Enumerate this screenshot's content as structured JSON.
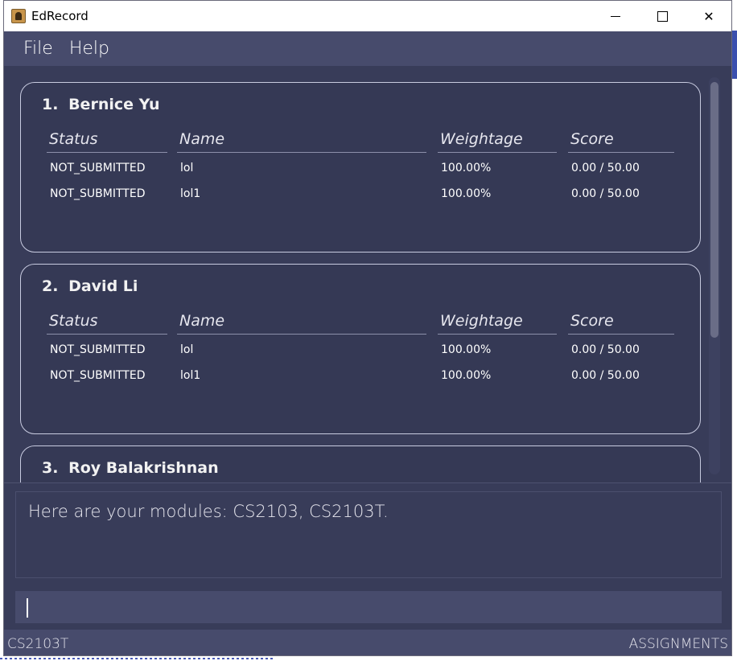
{
  "window": {
    "title": "EdRecord",
    "minimize_glyph": "",
    "close_glyph": "✕"
  },
  "menu": {
    "items": [
      {
        "label": "File"
      },
      {
        "label": "Help"
      }
    ]
  },
  "table_headers": [
    "Status",
    "Name",
    "Weightage",
    "Score"
  ],
  "students": [
    {
      "index": "1.",
      "name": "Bernice Yu",
      "assignments": [
        {
          "status": "NOT_SUBMITTED",
          "name": "lol",
          "weightage": "100.00%",
          "score": "0.00 / 50.00"
        },
        {
          "status": "NOT_SUBMITTED",
          "name": "lol1",
          "weightage": "100.00%",
          "score": "0.00 / 50.00"
        }
      ]
    },
    {
      "index": "2.",
      "name": "David Li",
      "assignments": [
        {
          "status": "NOT_SUBMITTED",
          "name": "lol",
          "weightage": "100.00%",
          "score": "0.00 / 50.00"
        },
        {
          "status": "NOT_SUBMITTED",
          "name": "lol1",
          "weightage": "100.00%",
          "score": "0.00 / 50.00"
        }
      ]
    },
    {
      "index": "3.",
      "name": "Roy Balakrishnan",
      "assignments": []
    }
  ],
  "result": {
    "message": "Here are your modules: CS2103, CS2103T."
  },
  "command": {
    "value": "",
    "placeholder": ""
  },
  "status_bar": {
    "module": "CS2103T",
    "view": "ASSIGNMENTS"
  },
  "icons": {
    "app": "edrecord-app-icon",
    "minimize": "minimize-icon",
    "maximize": "maximize-icon",
    "close": "close-icon"
  }
}
